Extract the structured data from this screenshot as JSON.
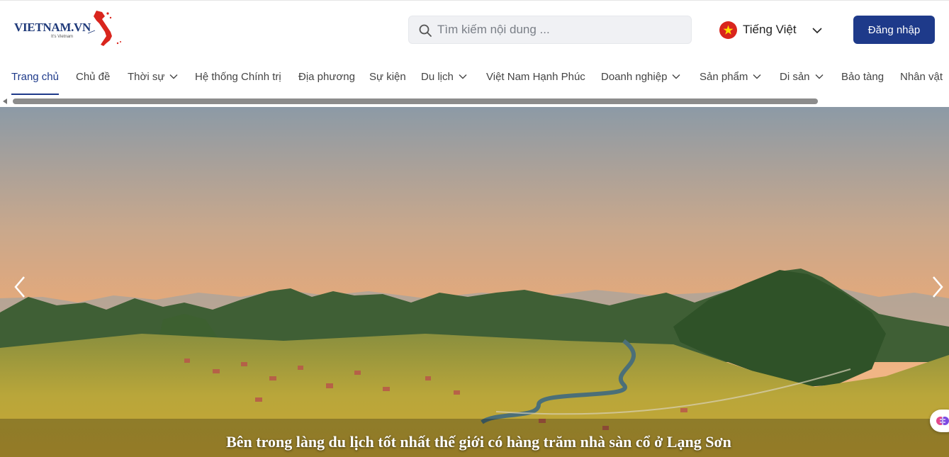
{
  "logo": {
    "text": "VIETNAM.VN",
    "tagline": "It's Vietnam"
  },
  "search": {
    "placeholder": "Tìm kiếm nội dung ..."
  },
  "language": {
    "label": "Tiếng Việt",
    "flag": "vietnam-flag"
  },
  "login": {
    "label": "Đăng nhập"
  },
  "nav": {
    "items": [
      {
        "label": "Trang chủ",
        "has_dropdown": false,
        "active": true
      },
      {
        "label": "Chủ đề",
        "has_dropdown": false
      },
      {
        "label": "Thời sự",
        "has_dropdown": true
      },
      {
        "label": "Hệ thống Chính trị",
        "has_dropdown": false
      },
      {
        "label": "Địa phương",
        "has_dropdown": false
      },
      {
        "label": "Sự kiện",
        "has_dropdown": false
      },
      {
        "label": "Du lịch",
        "has_dropdown": true
      },
      {
        "label": "Việt Nam Hạnh Phúc",
        "has_dropdown": false
      },
      {
        "label": "Doanh nghiệp",
        "has_dropdown": true
      },
      {
        "label": "Sản phẩm",
        "has_dropdown": true
      },
      {
        "label": "Di sản",
        "has_dropdown": true
      },
      {
        "label": "Bảo tàng",
        "has_dropdown": false
      },
      {
        "label": "Nhân vật",
        "has_dropdown": false
      }
    ]
  },
  "hero": {
    "caption": "Bên trong làng du lịch tốt nhất thế giới có hàng trăm nhà sàn cổ ở Lạng Sơn"
  },
  "colors": {
    "brand": "#1e3a8a",
    "flag_red": "#d9251d",
    "flag_star": "#ffde00"
  }
}
